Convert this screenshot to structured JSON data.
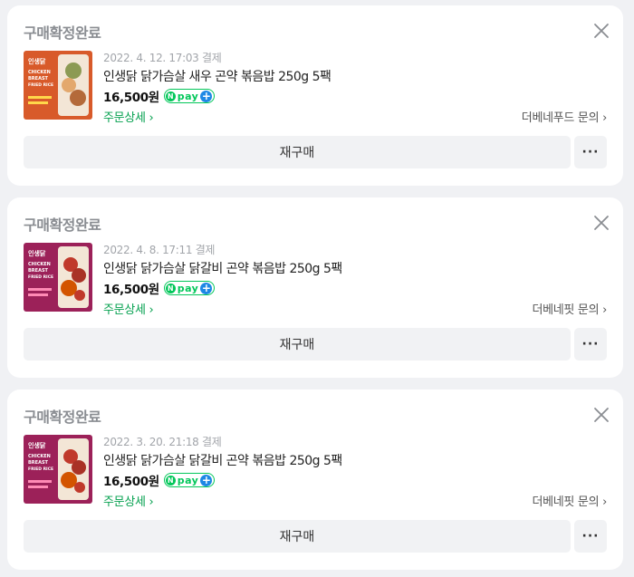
{
  "colors": {
    "accent_green": "#03c75a",
    "link_green": "#03a04e",
    "npay_plus_blue": "#1e88e5",
    "card_bg": "#ffffff",
    "page_bg": "#f0f1f4"
  },
  "orders": [
    {
      "status": "구매확정완료",
      "date": "2022. 4. 12. 17:03 결제",
      "product_name": "인생닭 닭가슴살 새우 곤약 볶음밥 250g 5팩",
      "price": "16,500원",
      "npay_label": "pay",
      "detail_link": "주문상세",
      "seller_inquiry": "더베네푸드 문의",
      "rebuy_label": "재구매",
      "more_label": "···",
      "thumb_color": "#d85a2a",
      "thumb_brand": "인생닭",
      "thumb_line1": "CHICKEN",
      "thumb_line2": "BREAST",
      "thumb_line3": "FRIED RICE"
    },
    {
      "status": "구매확정완료",
      "date": "2022. 4. 8. 17:11 결제",
      "product_name": "인생닭 닭가슴살 닭갈비 곤약 볶음밥 250g 5팩",
      "price": "16,500원",
      "npay_label": "pay",
      "detail_link": "주문상세",
      "seller_inquiry": "더베네핏 문의",
      "rebuy_label": "재구매",
      "more_label": "···",
      "thumb_color": "#9c2159",
      "thumb_brand": "인생닭",
      "thumb_line1": "CHICKEN",
      "thumb_line2": "BREAST",
      "thumb_line3": "FRIED RICE"
    },
    {
      "status": "구매확정완료",
      "date": "2022. 3. 20. 21:18 결제",
      "product_name": "인생닭 닭가슴살 닭갈비 곤약 볶음밥 250g 5팩",
      "price": "16,500원",
      "npay_label": "pay",
      "detail_link": "주문상세",
      "seller_inquiry": "더베네핏 문의",
      "rebuy_label": "재구매",
      "more_label": "···",
      "thumb_color": "#9c2159",
      "thumb_brand": "인생닭",
      "thumb_line1": "CHICKEN",
      "thumb_line2": "BREAST",
      "thumb_line3": "FRIED RICE"
    }
  ]
}
